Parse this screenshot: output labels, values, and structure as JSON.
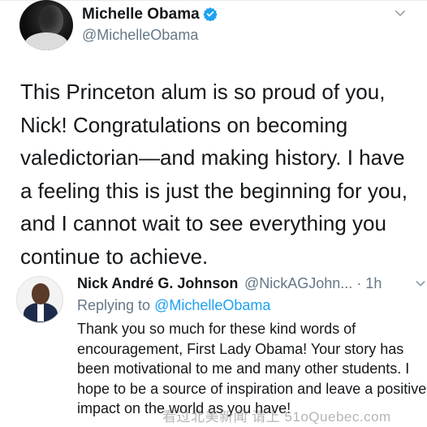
{
  "tweet": {
    "author_name": "Michelle Obama",
    "author_handle": "@MichelleObama",
    "text": "This Princeton alum is so proud of you, Nick! Congratulations on becoming valedictorian—and making history. I have a feeling this is just the beginning for you, and I cannot wait to see everything you continue to achieve."
  },
  "reply": {
    "author_name": "Nick André G. Johnson",
    "author_handle_time": "@NickAGJohn... · 1h",
    "replying_prefix": "Replying to ",
    "replying_to": "@MichelleObama",
    "text": "Thank you so much for these kind words of encouragement, First Lady Obama! Your story has been motivational to me and many other students. I hope to be a source of inspiration and leave a positive impact on the world as you have!"
  },
  "watermark": "看过北美新闻 请上 51oQuebec.com",
  "colors": {
    "text": "#14171a",
    "secondary": "#657786",
    "link": "#1da1f2",
    "verified": "#1da1f2"
  },
  "icons": [
    "verified-badge-icon",
    "chevron-down-icon"
  ]
}
